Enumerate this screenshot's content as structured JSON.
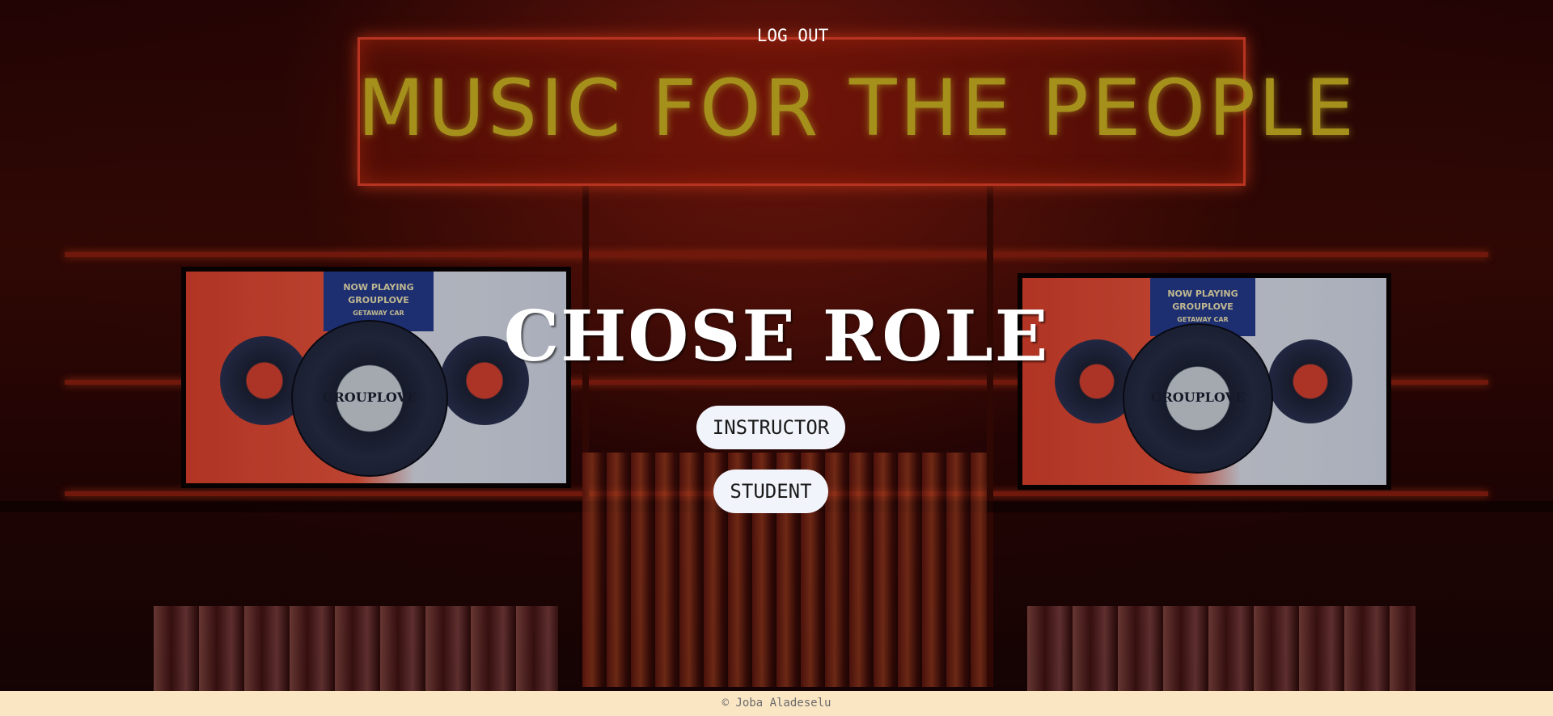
{
  "header": {
    "logout_label": "LOG OUT"
  },
  "background": {
    "neon_sign_text": "MUSIC FOR THE PEOPLE",
    "screen_left": {
      "now_playing": "NOW PLAYING",
      "artist": "GROUPLOVE",
      "track": "GETAWAY CAR",
      "record_label": "GROUPLOVE"
    },
    "screen_right": {
      "now_playing": "NOW PLAYING",
      "artist": "GROUPLOVE",
      "track": "GETAWAY CAR",
      "record_label": "GROUPLOVE"
    }
  },
  "main": {
    "title": "CHOSE ROLE",
    "roles": [
      {
        "label": "INSTRUCTOR"
      },
      {
        "label": "STUDENT"
      }
    ]
  },
  "footer": {
    "text": "© Joba Aladeselu"
  },
  "colors": {
    "footer_bg": "#fbe6c4",
    "button_bg": "#f2f4fb",
    "neon_text": "#c9b022",
    "neon_frame": "#e0402a"
  }
}
